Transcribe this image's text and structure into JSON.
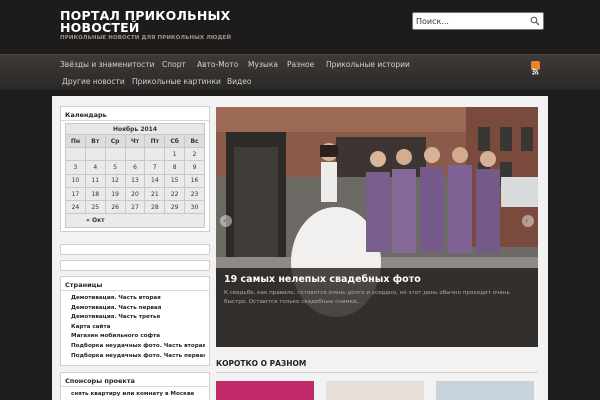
{
  "header": {
    "title": "ПОРТАЛ ПРИКОЛЬНЫХ НОВОСТЕЙ",
    "subtitle": "ПРИКОЛЬНЫЕ НОВОСТИ ДЛЯ ПРИКОЛЬНЫХ ЛЮДЕЙ",
    "search_placeholder": "Поиск..."
  },
  "nav": {
    "items": [
      "Звёзды и знаменитости",
      "Спорт",
      "Авто-Мото",
      "Музыка",
      "Разное",
      "Прикольные истории",
      "Другие новости",
      "Прикольные картинки",
      "Видео"
    ],
    "rss_icon": "rss-icon"
  },
  "sidebar": {
    "calendar_title": "Календарь",
    "calendar": {
      "caption": "Ноябрь 2014",
      "weekdays": [
        "Пн",
        "Вт",
        "Ср",
        "Чт",
        "Пт",
        "Сб",
        "Вс"
      ],
      "weeks": [
        [
          "",
          "",
          "",
          "",
          "",
          "1",
          "2"
        ],
        [
          "3",
          "4",
          "5",
          "6",
          "7",
          "8",
          "9"
        ],
        [
          "10",
          "11",
          "12",
          "13",
          "14",
          "15",
          "16"
        ],
        [
          "17",
          "18",
          "19",
          "20",
          "21",
          "22",
          "23"
        ],
        [
          "24",
          "25",
          "26",
          "27",
          "28",
          "29",
          "30"
        ]
      ],
      "prev_link": "« Окт"
    },
    "pages_title": "Страницы",
    "pages": [
      "Демотивация. Часть вторая",
      "Демотивация. Часть первая",
      "Демотивация. Часть третья",
      "Карта сайта",
      "Магазин мобильного софта",
      "Подборка неудачных фото. Часть вторая",
      "Подборка неудачных фото. Часть первая"
    ],
    "sponsors_title": "Спонсоры проекта",
    "sponsor_link": "снять квартиру или комнату в Москве"
  },
  "slider": {
    "title": "19 самых нелепых свадебных фото",
    "text": "К свадьбе, как правило, готовятся очень долго и усердно, но этот день обычно проходит очень быстро. Остаются только свадебные снимки,…"
  },
  "section": {
    "title": "КОРОТКО О РАЗНОМ"
  },
  "colors": {
    "accent": "#c33333",
    "header_bg": "#1e1c1b",
    "nav_bg": "#343130"
  }
}
